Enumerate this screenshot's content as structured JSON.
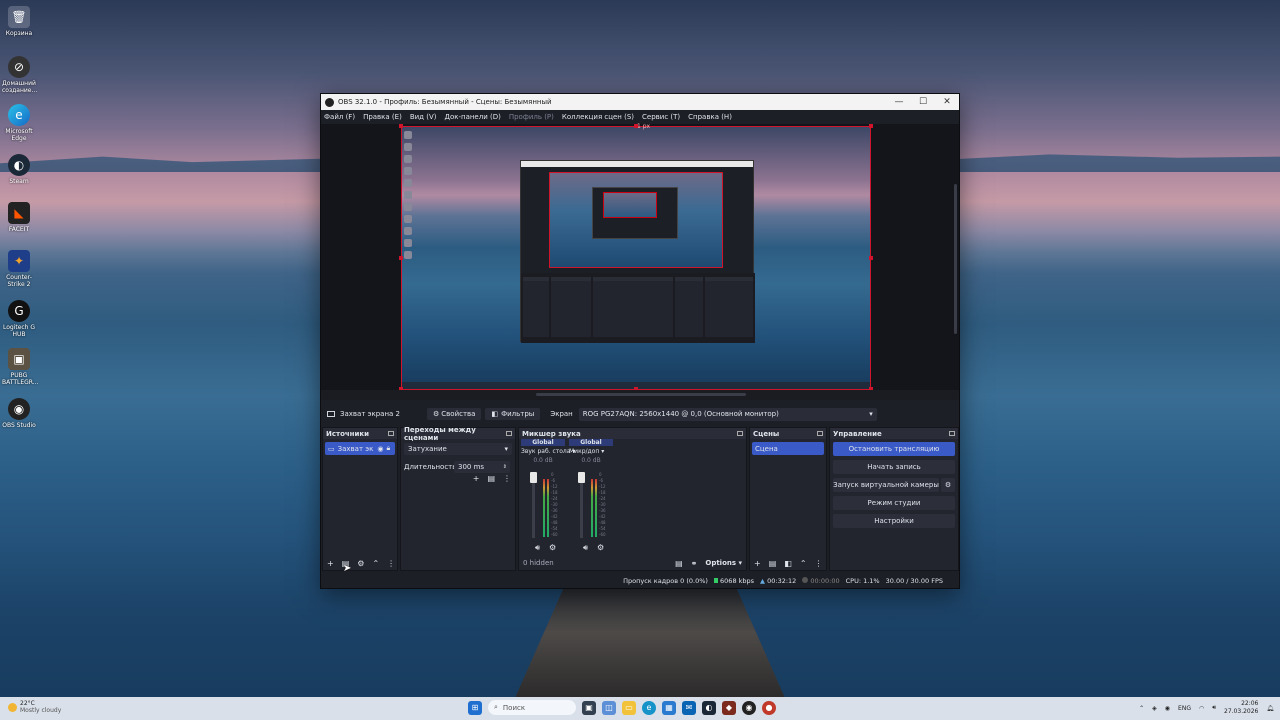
{
  "desktop": {
    "icons": [
      {
        "label": "Корзина",
        "icon": "recycle-bin-icon"
      },
      {
        "label": "Домашний создание...",
        "icon": "network-icon"
      },
      {
        "label": "Microsoft Edge",
        "icon": "edge-icon"
      },
      {
        "label": "Steam",
        "icon": "steam-icon"
      },
      {
        "label": "FACEIT",
        "icon": "faceit-icon"
      },
      {
        "label": "Counter-Strike 2",
        "icon": "cs2-icon"
      },
      {
        "label": "Logitech G HUB",
        "icon": "logitech-icon"
      },
      {
        "label": "PUBG BATTLEGR...",
        "icon": "pubg-icon"
      },
      {
        "label": "OBS Studio",
        "icon": "obs-icon"
      }
    ]
  },
  "window": {
    "title": "OBS 32.1.0 - Профиль: Безымянный - Сцены: Безымянный",
    "controls": {
      "minimize": "—",
      "maximize": "☐",
      "close": "✕"
    }
  },
  "menu": [
    {
      "label": "Файл (F)"
    },
    {
      "label": "Правка (E)"
    },
    {
      "label": "Вид (V)"
    },
    {
      "label": "Док-панели (D)"
    },
    {
      "label": "Профиль (P)"
    },
    {
      "label": "Коллекция сцен (S)"
    },
    {
      "label": "Сервис (T)"
    },
    {
      "label": "Справка (H)"
    }
  ],
  "preview": {
    "size_label": "1 px"
  },
  "source_toolbar": {
    "source_name": "Захват экрана 2",
    "properties": "Свойства",
    "filters": "Фильтры",
    "screen_label": "Экран",
    "screen_value": "ROG PG27AQN: 2560x1440 @ 0,0 (Основной монитор)"
  },
  "docks": {
    "sources": {
      "title": "Источники",
      "item": "Захват эк"
    },
    "transitions": {
      "title": "Переходы между сценами",
      "transition": "Затухание",
      "duration_label": "Длительность",
      "duration_value": "300 ms"
    },
    "mixer": {
      "title": "Микшер звука",
      "channels": [
        {
          "badge": "Global",
          "name": "Звук раб. стола",
          "db": "0.0 dB",
          "level": 0.7
        },
        {
          "badge": "Global",
          "name": "Микр/доп",
          "db": "0.0 dB",
          "level": 0.6
        }
      ],
      "ticks": [
        "0",
        "-6",
        "-12",
        "-18",
        "-24",
        "-30",
        "-36",
        "-42",
        "-48",
        "-54",
        "-60"
      ],
      "hidden": "0 hidden",
      "options": "Options"
    },
    "scenes": {
      "title": "Сцены",
      "item": "Сцена"
    },
    "controls": {
      "title": "Управление",
      "stop_stream": "Остановить трансляцию",
      "start_record": "Начать запись",
      "virtual_cam": "Запуск виртуальной камеры",
      "studio_mode": "Режим студии",
      "settings": "Настройки"
    }
  },
  "status": {
    "dropped": "Пропуск кадров 0 (0.0%)",
    "bitrate": "6068 kbps",
    "stream_time": "00:32:12",
    "record_time": "00:00:00",
    "cpu": "CPU: 1.1%",
    "fps": "30.00 / 30.00 FPS"
  },
  "taskbar": {
    "weather_temp": "22°C",
    "weather_desc": "Mostly cloudy",
    "search": "Поиск",
    "lang": "ENG",
    "time": "22:06",
    "date": "27.03.2026"
  },
  "colors": {
    "accent": "#3a5ac8",
    "preview_border": "#d0142c",
    "window_bg": "#1d1f26"
  }
}
